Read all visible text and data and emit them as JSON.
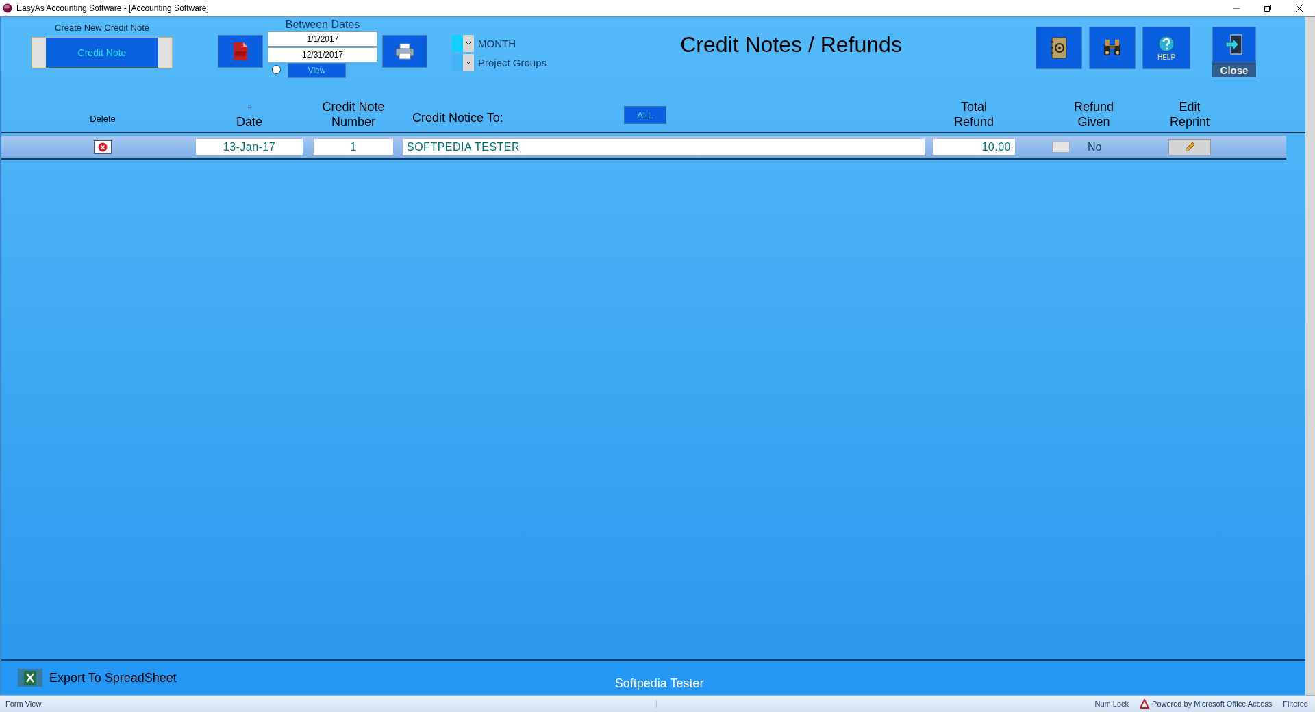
{
  "window": {
    "title": "EasyAs Accounting Software - [Accounting Software]"
  },
  "header": {
    "create_label": "Create New Credit Note",
    "create_button": "Credit Note",
    "dates_label": "Between Dates",
    "date_from": "1/1/2017",
    "date_to": "12/31/2017",
    "view_radio": {
      "selected": false
    },
    "view_button": "View",
    "filters": [
      {
        "label": "MONTH",
        "selected": true
      },
      {
        "label": "Project Groups",
        "selected": false
      }
    ],
    "title": "Credit Notes / Refunds",
    "tools": [
      {
        "kind": "contacts"
      },
      {
        "kind": "search"
      },
      {
        "kind": "help",
        "label": "HELP"
      }
    ],
    "close_button": "Close"
  },
  "table": {
    "columns": [
      [
        "Delete"
      ],
      [
        "-",
        "Date"
      ],
      [
        "Credit Note",
        "Number"
      ],
      [
        "Credit Notice To:"
      ],
      [
        "Total",
        "Refund"
      ],
      [
        "Refund",
        "Given"
      ],
      [
        "Edit",
        "Reprint"
      ]
    ],
    "all_button": "ALL",
    "rows": [
      {
        "date": "13-Jan-17",
        "number": "1",
        "customer": "SOFTPEDIA TESTER",
        "total": "10.00",
        "refund_given": false,
        "refund_label": "No"
      }
    ]
  },
  "footer": {
    "export_button": "Export To SpreadSheet",
    "user": "Softpedia Tester"
  },
  "status_bar": {
    "left": "Form View",
    "right": [
      "Num Lock",
      "Powered by Microsoft Office Access",
      "Filtered"
    ]
  }
}
